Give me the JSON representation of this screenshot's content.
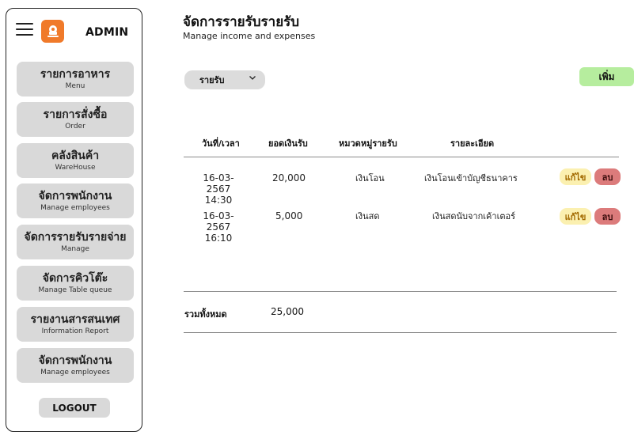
{
  "sidebar": {
    "admin_title": "ADMIN",
    "items": [
      {
        "th": "รายการอาหาร",
        "en": "Menu"
      },
      {
        "th": "รายการสั่งซื้อ",
        "en": "Order"
      },
      {
        "th": "คลังสินค้า",
        "en": "WareHouse"
      },
      {
        "th": "จัดการพนักงาน",
        "en": "Manage employees"
      },
      {
        "th": "จัดการรายรับรายจ่าย",
        "en": "Manage"
      },
      {
        "th": "จัดการคิวโต๊ะ",
        "en": "Manage Table queue"
      },
      {
        "th": "รายงานสารสนเทศ",
        "en": "Information Report"
      },
      {
        "th": "จัดการพนักงาน",
        "en": "Manage employees"
      }
    ],
    "logout_label": "LOGOUT"
  },
  "header": {
    "title": "จัดการรายรับรายรับ",
    "subtitle": "Manage income and expenses"
  },
  "filter": {
    "selected": "รายรับ",
    "chevron_icon": "chevron-down-icon"
  },
  "add_label": "เพิ่ม",
  "table": {
    "columns": [
      "วันที่/เวลา",
      "ยอดเงินรับ",
      "หมวดหมู่รายรับ",
      "รายละเอียด"
    ],
    "rows": [
      {
        "date": "16-03-2567",
        "time": "14:30",
        "amount": "20,000",
        "category": "เงินโอน",
        "detail": "เงินโอนเข้าบัญชีธนาคาร",
        "edit": "แก้ไข",
        "delete": "ลบ"
      },
      {
        "date": "16-03-2567",
        "time": "16:10",
        "amount": "5,000",
        "category": "เงินสด",
        "detail": "เงินสดนับจากเค้าเตอร์",
        "edit": "แก้ไข",
        "delete": "ลบ"
      }
    ],
    "total_label": "รวมทั้งหมด",
    "total_value": "25,000"
  },
  "colors": {
    "menu_bg": "#d9d9d9",
    "add_bg": "#b6ed9e",
    "edit_bg": "#fbf0b0",
    "delete_bg": "#dc7b7b",
    "logo_bg": "#f07a2a"
  }
}
